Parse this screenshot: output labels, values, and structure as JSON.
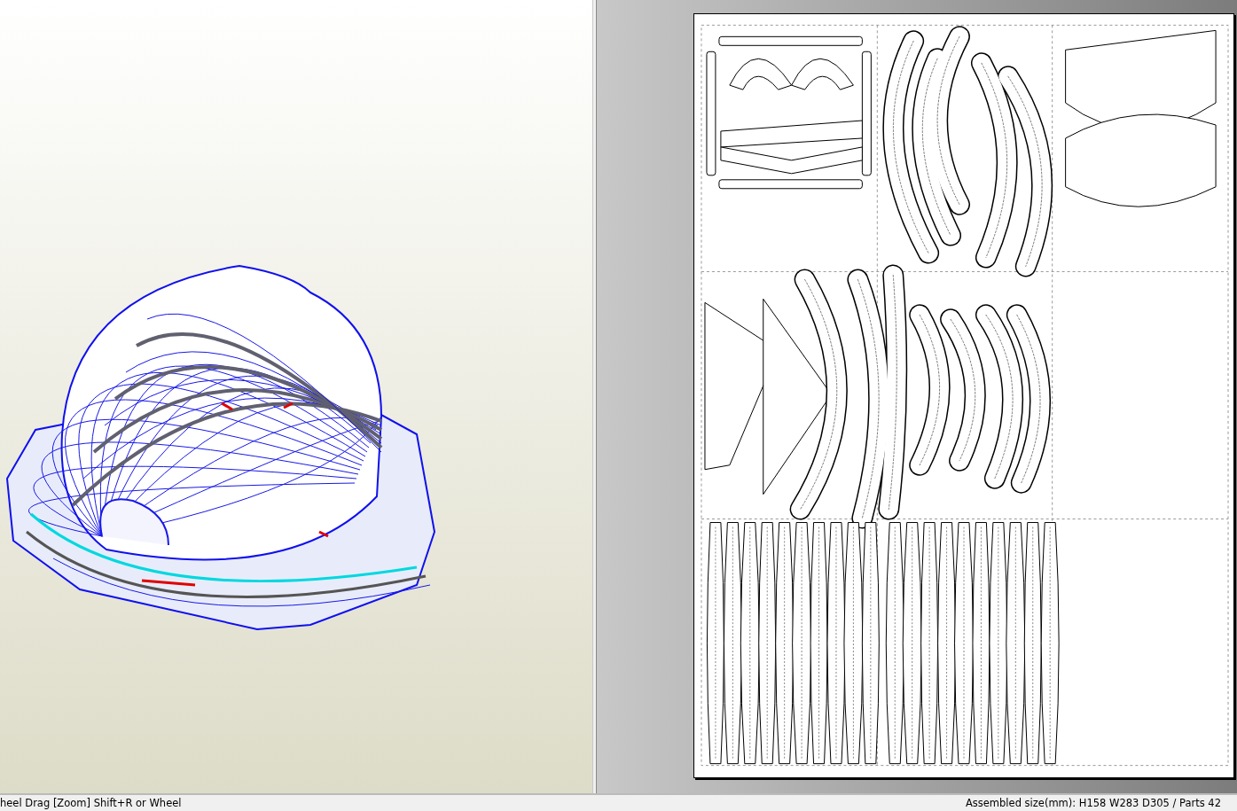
{
  "status_bar": {
    "left": "heel Drag [Zoom] Shift+R or Wheel",
    "right": "Assembled size(mm): H158 W283 D305 / Parts 42"
  }
}
